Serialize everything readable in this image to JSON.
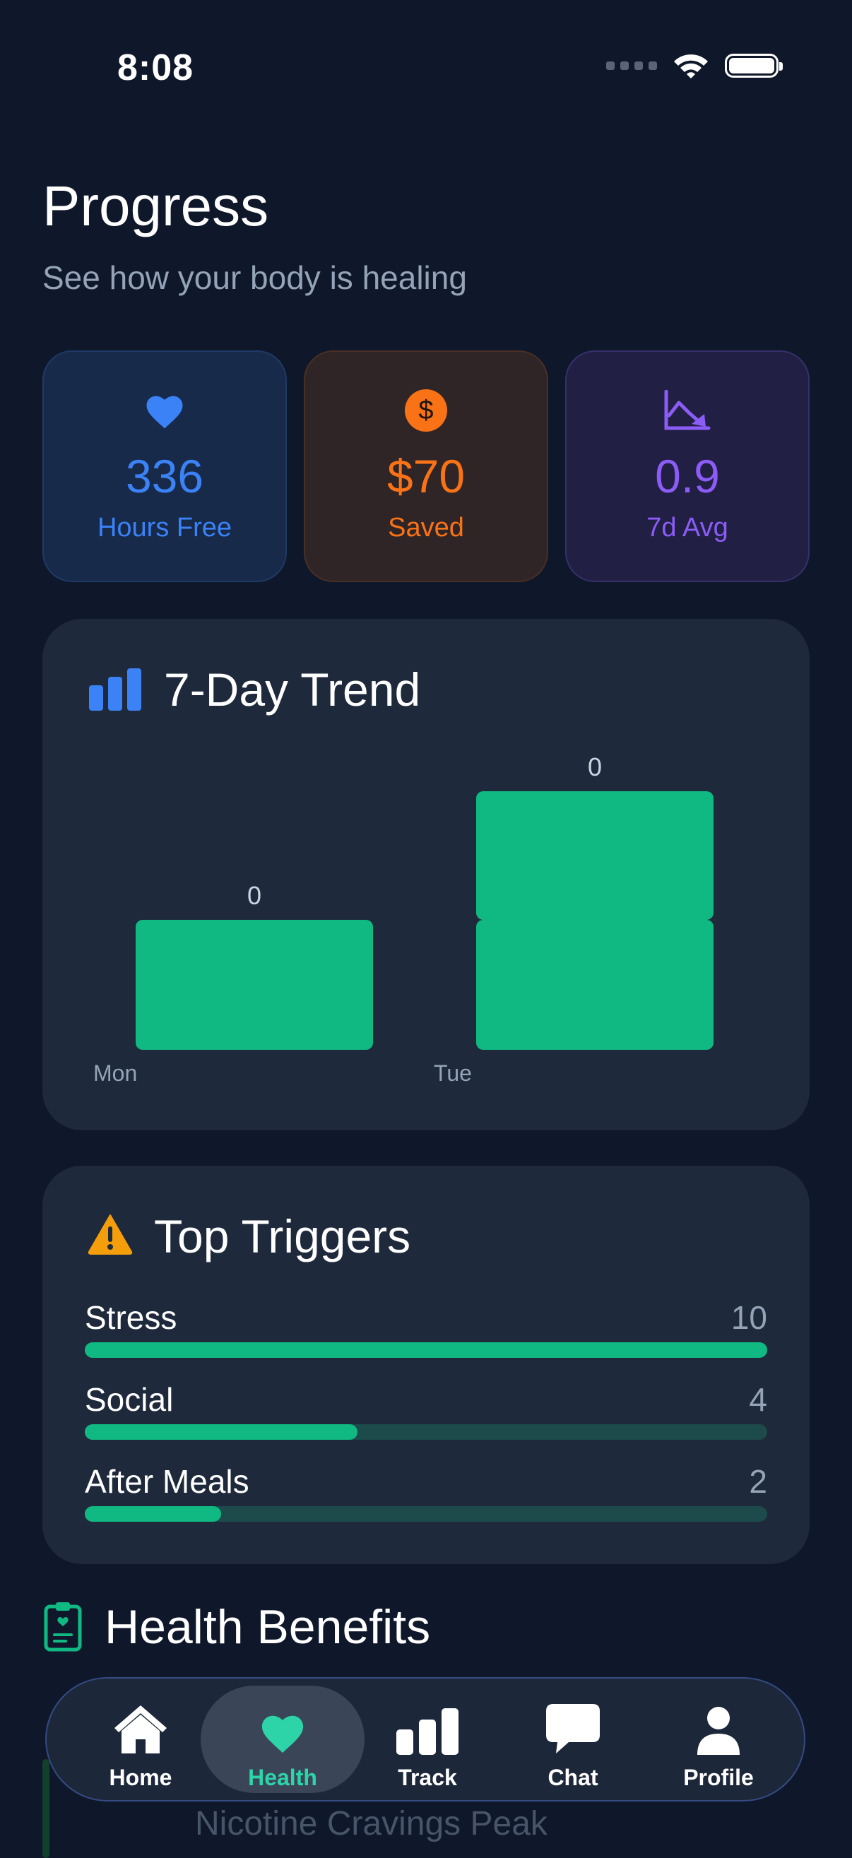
{
  "status_bar": {
    "time": "8:08"
  },
  "header": {
    "title": "Progress",
    "subtitle": "See how your body is healing"
  },
  "stats": [
    {
      "value": "336",
      "label": "Hours Free",
      "icon": "heart-icon",
      "color": "#3b82f6"
    },
    {
      "value": "$70",
      "label": "Saved",
      "icon": "dollar-coin-icon",
      "color": "#f97316"
    },
    {
      "value": "0.9",
      "label": "7d Avg",
      "icon": "trend-down-icon",
      "color": "#8b5cf6"
    }
  ],
  "trend": {
    "title": "7-Day Trend",
    "icon": "bar-chart-icon"
  },
  "chart_data": {
    "type": "bar",
    "title": "7-Day Trend",
    "categories": [
      "Mon",
      "Tue"
    ],
    "stacks": [
      {
        "category": "Mon",
        "segments": 1,
        "label": "0"
      },
      {
        "category": "Tue",
        "segments": 2,
        "label": "0"
      }
    ],
    "bar_color": "#10b981"
  },
  "triggers": {
    "title": "Top Triggers",
    "icon": "warning-icon",
    "max": 10,
    "items": [
      {
        "name": "Stress",
        "count": "10",
        "value": 10
      },
      {
        "name": "Social",
        "count": "4",
        "value": 4
      },
      {
        "name": "After Meals",
        "count": "2",
        "value": 2
      }
    ]
  },
  "benefits": {
    "title": "Health Benefits",
    "icon": "clipboard-heart-icon",
    "first_item": "Nicotine Cravings Peak"
  },
  "tab_bar": {
    "active": "Health",
    "tabs": [
      {
        "label": "Home",
        "icon": "home-icon"
      },
      {
        "label": "Health",
        "icon": "heart-icon"
      },
      {
        "label": "Track",
        "icon": "bar-chart-icon"
      },
      {
        "label": "Chat",
        "icon": "chat-bubble-icon"
      },
      {
        "label": "Profile",
        "icon": "person-icon"
      }
    ]
  },
  "colors": {
    "background": "#0f172a",
    "card": "#1e293b",
    "accent_green": "#10b981",
    "active_tab_text": "#2dd4a8"
  }
}
